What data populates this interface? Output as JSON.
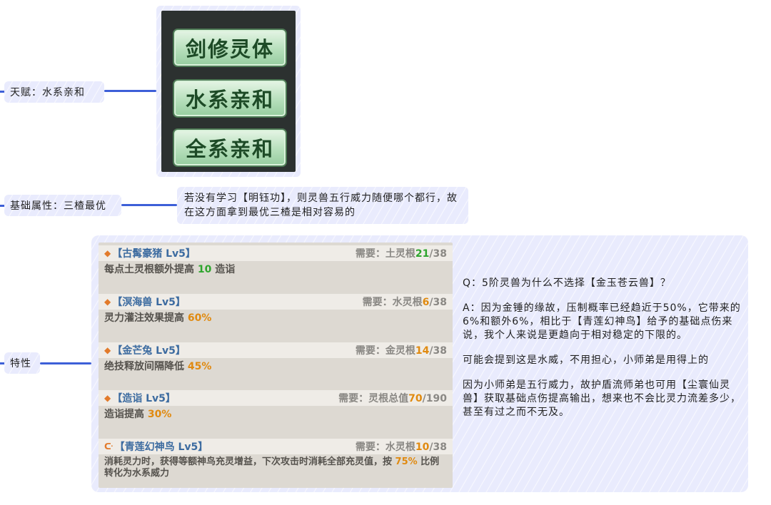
{
  "nodes": {
    "talent": "天赋：水系亲和",
    "attribute": "基础属性：三楂最优",
    "traits": "特性"
  },
  "talent_tags": [
    "剑修灵体",
    "水系亲和",
    "全系亲和"
  ],
  "attribute_note": "若没有学习【明钰功】，则灵兽五行威力随便哪个都行，故在这方面拿到最优三楂是相对容易的",
  "traits": [
    {
      "name": "【古髯豪猪 Lv5】",
      "icon": "diamond-icon",
      "req_label": "需要：土灵根",
      "req_current": "21",
      "req_total": "/38",
      "desc_prefix": "每点土灵根额外提高 ",
      "desc_value": "10",
      "desc_suffix": " 造诣"
    },
    {
      "name": "【溟海兽 Lv5】",
      "icon": "diamond-icon",
      "req_label": "需要：水灵根",
      "req_current": "6",
      "req_total": "/38",
      "desc_prefix": "灵力灌注效果提高 ",
      "desc_value": "60%",
      "desc_suffix": ""
    },
    {
      "name": "【金芒兔 Lv5】",
      "icon": "diamond-icon",
      "req_label": "需要：金灵根",
      "req_current": "14",
      "req_total": "/38",
      "desc_prefix": "绝技释放间隔降低 ",
      "desc_value": "45%",
      "desc_suffix": ""
    },
    {
      "name": "【造诣 Lv5】",
      "icon": "diamond-icon",
      "req_label": "需要：灵根总值",
      "req_current": "70",
      "req_total": "/190",
      "desc_prefix": "造诣提高 ",
      "desc_value": "30%",
      "desc_suffix": ""
    },
    {
      "name": "【青莲幻神鸟 Lv5】",
      "icon": "swirl-icon",
      "req_label": "需要：水灵根",
      "req_current": "10",
      "req_total": "/38",
      "desc_prefix": "消耗灵力时，获得等额神鸟充灵增益，下次攻击时消耗全部充灵值，按 ",
      "desc_value": "75%",
      "desc_suffix": " 比例转化为水系威力"
    }
  ],
  "qa": {
    "q": "Q：5阶灵兽为什么不选择【金玉苍云兽】？",
    "a": "A：因为金锤的缘故，压制概率已经趋近于50%，它带来的6%和额外6%，相比于【青莲幻神鸟】给予的基础点伤来说，我个人来说是更趋向于相对稳定的下限的。",
    "p2": "可能会提到这是水威，不用担心，小师弟是用得上的",
    "p3": "因为小师弟是五行威力，故护盾流师弟也可用【尘寰仙灵兽】获取基础点伤提高输出，想来也不会比灵力流差多少，甚至有过之而不无及。"
  },
  "colors": {
    "connector": "#3d5fd8",
    "panel": "#e9ebfd",
    "highlight_green": "#2ea52e",
    "highlight_orange": "#e08a10",
    "trait_name": "#3c6ba0"
  }
}
